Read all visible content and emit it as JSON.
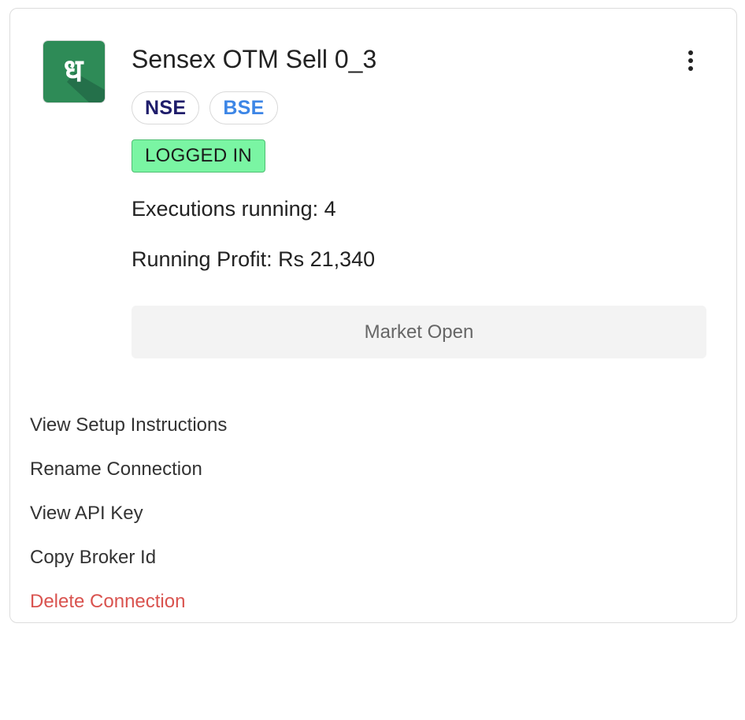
{
  "card": {
    "logo": {
      "icon": "dhanuk-letter-icon",
      "glyph": "ध",
      "bg_color": "#2e8b57"
    },
    "title": "Sensex OTM Sell 0_3",
    "menu_icon": "kebab-menu-icon",
    "exchanges": [
      {
        "label": "NSE",
        "color": "#1f1d6b"
      },
      {
        "label": "BSE",
        "color": "#3d86e6"
      }
    ],
    "status": {
      "label": "LOGGED IN",
      "color": "#7af5a3"
    },
    "executions_text": "Executions running: 4",
    "profit_text": "Running Profit: Rs 21,340",
    "market_button_label": "Market Open"
  },
  "menu": {
    "items": [
      {
        "label": "View Setup Instructions"
      },
      {
        "label": "Rename Connection"
      },
      {
        "label": "View API Key"
      },
      {
        "label": "Copy Broker Id"
      },
      {
        "label": "Delete Connection",
        "color": "#d9534f"
      }
    ]
  }
}
